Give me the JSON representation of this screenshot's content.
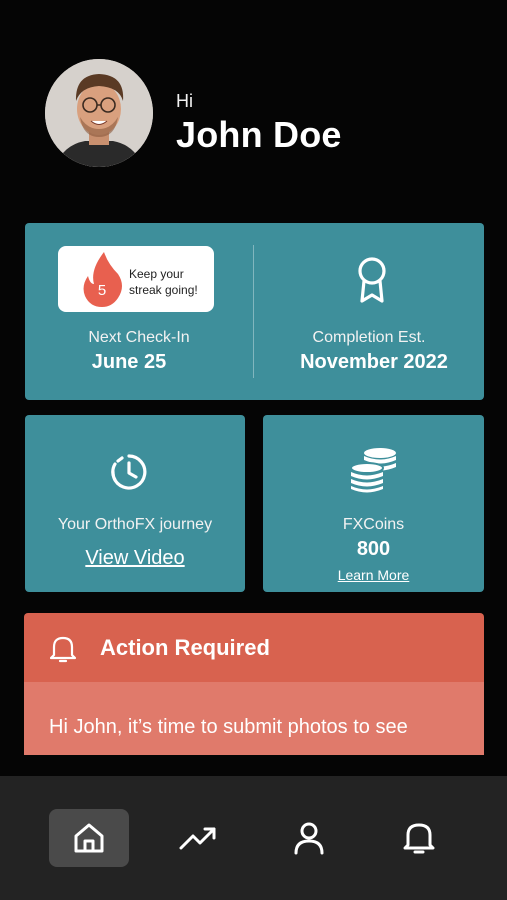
{
  "header": {
    "greeting": "Hi",
    "name": "John Doe",
    "avatar_icon": "user-avatar-photo"
  },
  "summary_card": {
    "streak": {
      "count": "5",
      "text": "Keep your streak going!",
      "icon": "flame-icon",
      "flame_color": "#e8604f"
    },
    "next_checkin": {
      "label": "Next Check-In",
      "value": "June 25"
    },
    "completion": {
      "label": "Completion Est.",
      "value": "November 2022",
      "icon": "award-ribbon-icon"
    }
  },
  "journey_card": {
    "icon": "history-clock-icon",
    "title": "Your OrthoFX journey",
    "link": "View Video"
  },
  "coins_card": {
    "icon": "coins-stack-icon",
    "title": "FXCoins",
    "value": "800",
    "link": "Learn More"
  },
  "action_required": {
    "icon": "bell-icon",
    "title": "Action Required",
    "message": "Hi John, it’s time to submit photos to see",
    "head_color": "#d8624f",
    "body_color": "#e07a6b"
  },
  "nav": {
    "items": [
      {
        "name": "home",
        "icon": "home-icon",
        "active": true
      },
      {
        "name": "progress",
        "icon": "trending-up-icon",
        "active": false
      },
      {
        "name": "profile",
        "icon": "user-icon",
        "active": false
      },
      {
        "name": "notifications",
        "icon": "bell-icon",
        "active": false
      }
    ]
  },
  "colors": {
    "background": "#050505",
    "card": "#3e8f9b",
    "nav": "#232323",
    "nav_active": "#4a4a4a"
  }
}
